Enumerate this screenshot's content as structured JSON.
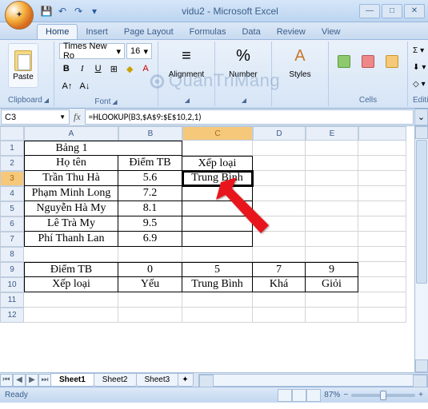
{
  "title": "vidu2 - Microsoft Excel",
  "qat": {
    "save": "💾",
    "undo": "↶",
    "redo": "↷",
    "dd": "▾"
  },
  "tabs": [
    "Home",
    "Insert",
    "Page Layout",
    "Formulas",
    "Data",
    "Review",
    "View"
  ],
  "ribbon": {
    "paste": "Paste",
    "clipboard": "Clipboard",
    "font_name": "Times New Ro",
    "font_size": "16",
    "font": "Font",
    "alignment": "Alignment",
    "number": "Number",
    "styles": "Styles",
    "cells": "Cells",
    "editing": "Editing",
    "sigma": "Σ",
    "fill": "⬇",
    "clear": "◇"
  },
  "namebox": "C3",
  "fx": "fx",
  "formula": "=HLOOKUP(B3,$A$9:$E$10,2,1)",
  "cols": [
    "A",
    "B",
    "C",
    "D",
    "E"
  ],
  "rows": [
    "1",
    "2",
    "3",
    "4",
    "5",
    "6",
    "7",
    "8",
    "9",
    "10",
    "11",
    "12"
  ],
  "grid": {
    "r1": {
      "A": "Bảng 1"
    },
    "r2": {
      "A": "Họ tên",
      "B": "Điểm TB",
      "C": "Xếp loại"
    },
    "r3": {
      "A": "Trần Thu Hà",
      "B": "5.6",
      "C": "Trung Bình"
    },
    "r4": {
      "A": "Phạm Minh Long",
      "B": "7.2"
    },
    "r5": {
      "A": "Nguyễn Hà My",
      "B": "8.1"
    },
    "r6": {
      "A": "Lê Trà My",
      "B": "9.5"
    },
    "r7": {
      "A": "Phí Thanh Lan",
      "B": "6.9"
    },
    "r9": {
      "A": "Điểm TB",
      "B": "0",
      "C": "5",
      "D": "7",
      "E": "9"
    },
    "r10": {
      "A": "Xếp loại",
      "B": "Yếu",
      "C": "Trung Bình",
      "D": "Khá",
      "E": "Giỏi"
    }
  },
  "sheets": [
    "Sheet1",
    "Sheet2",
    "Sheet3"
  ],
  "status": "Ready",
  "zoom": "87%",
  "watermark": "QuanTriMang"
}
